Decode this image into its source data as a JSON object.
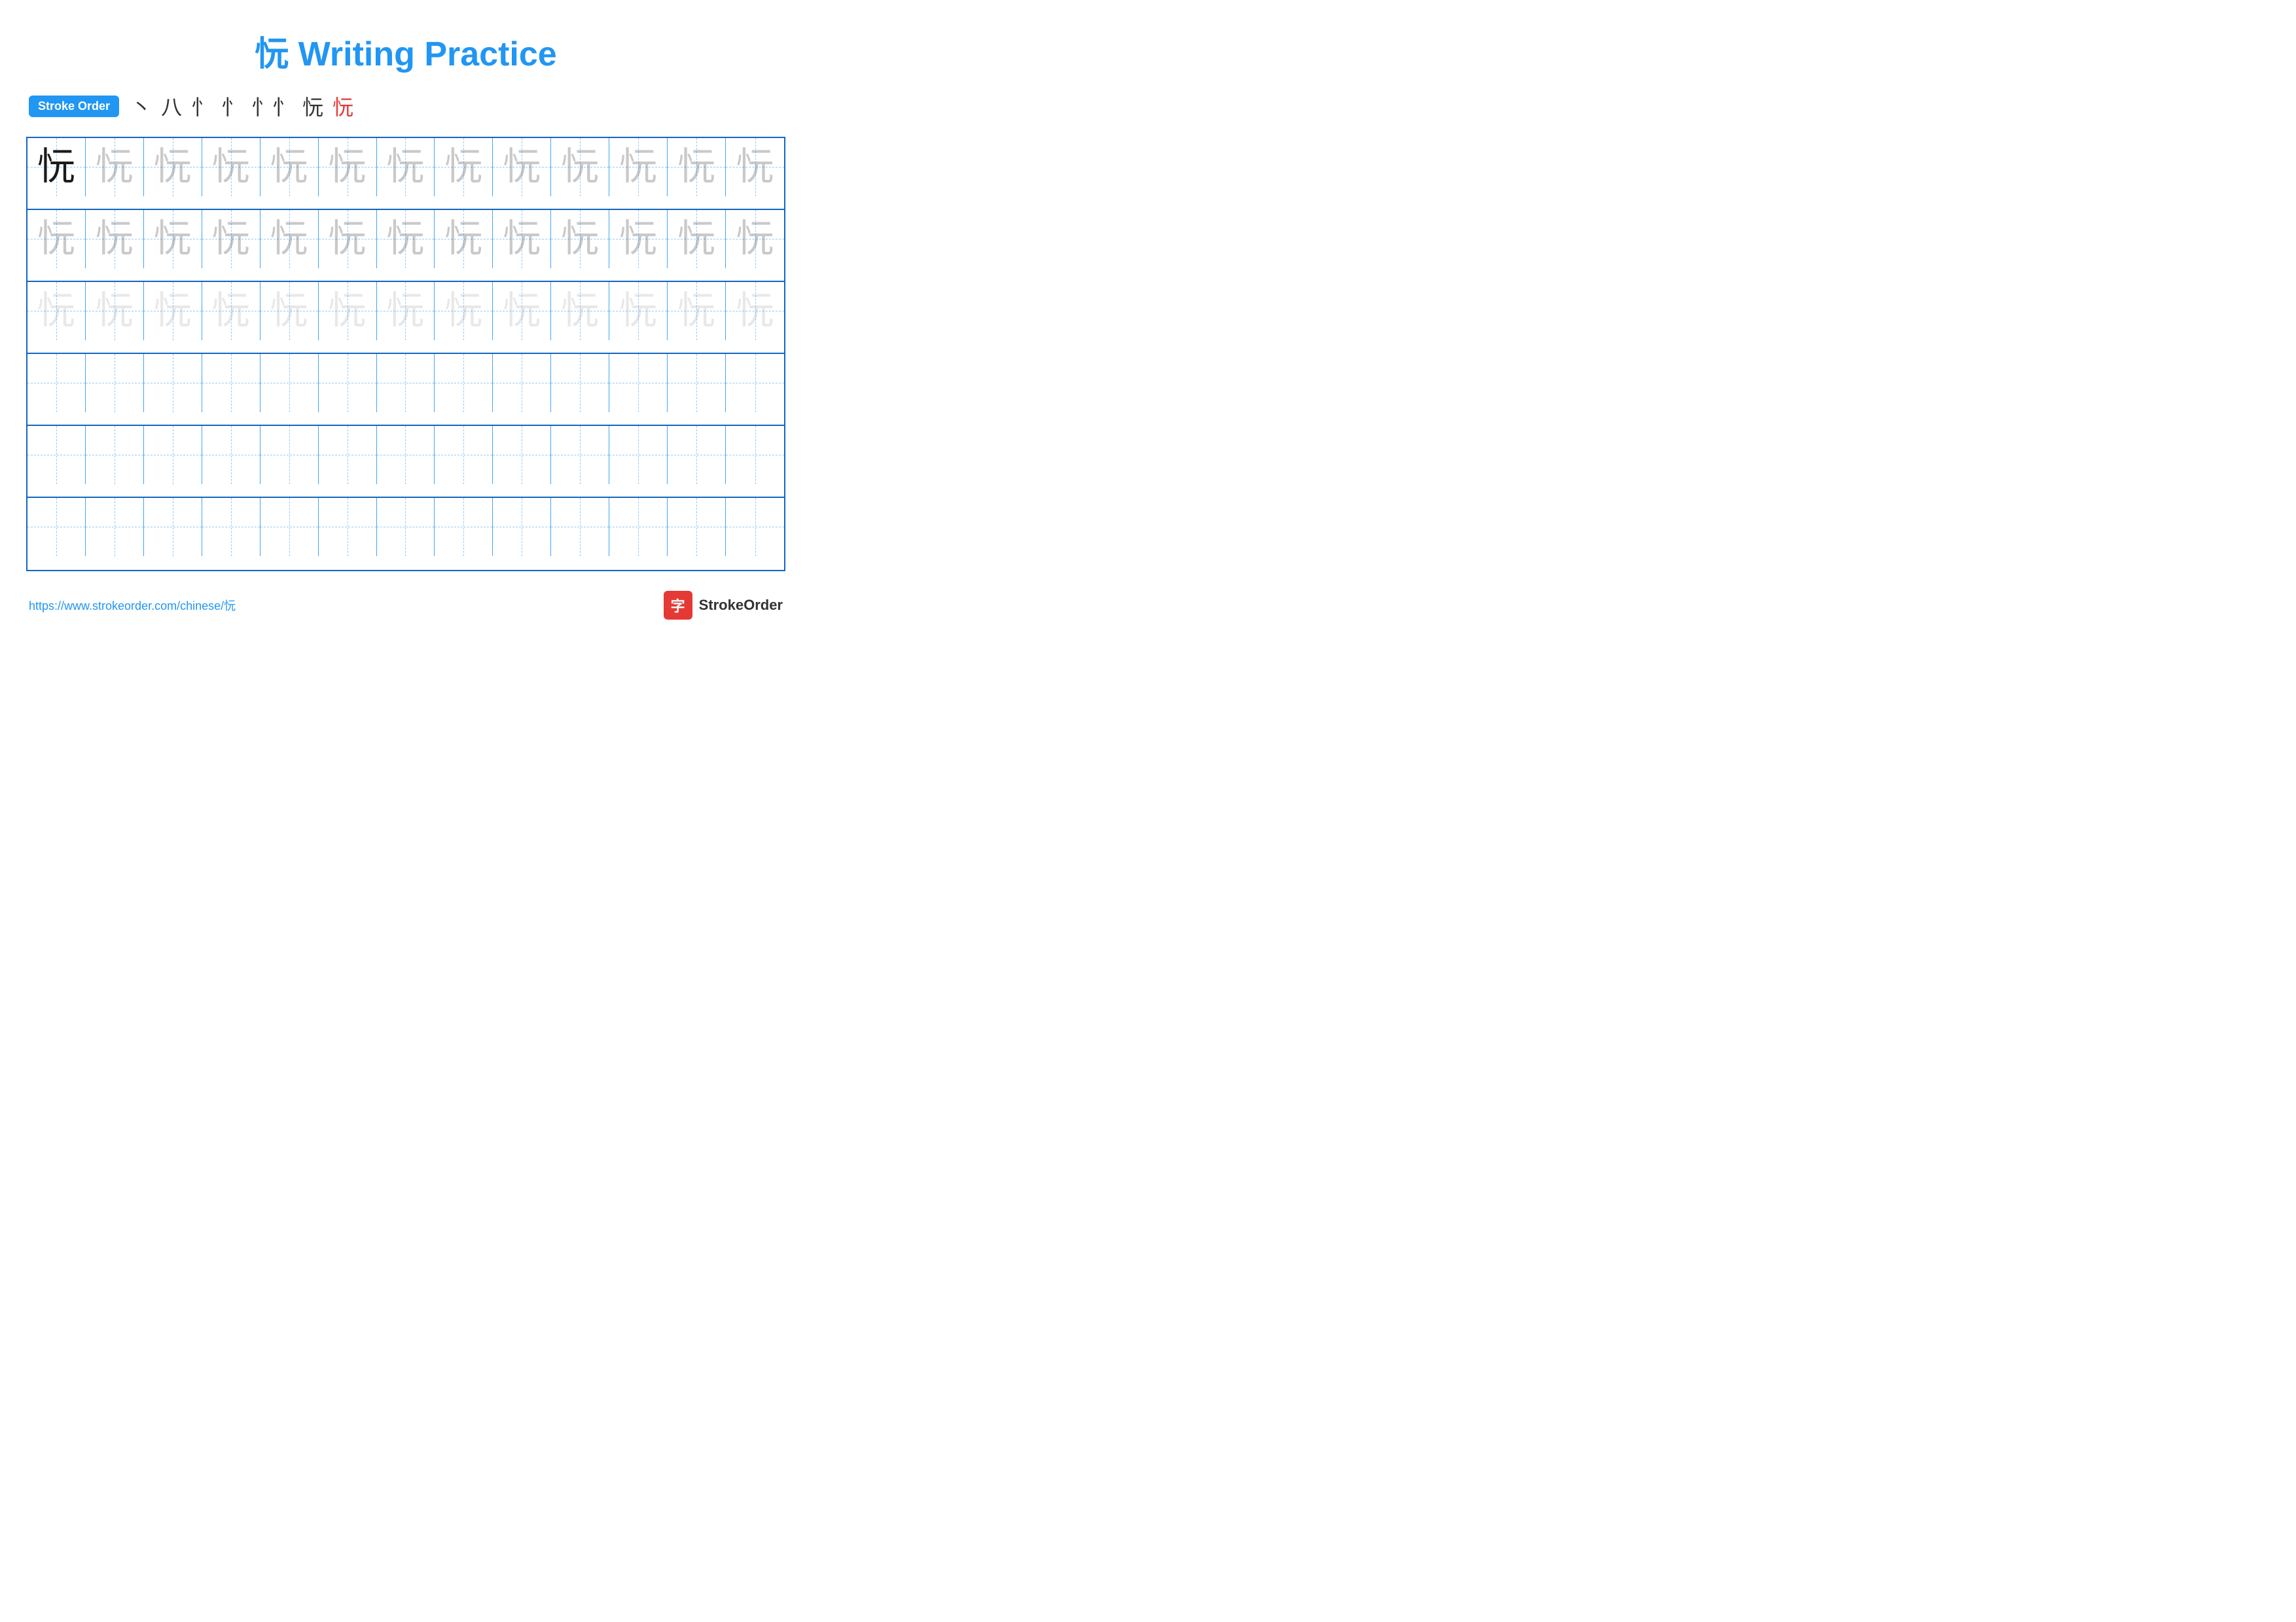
{
  "title": "忨 Writing Practice",
  "stroke_order": {
    "label": "Stroke Order",
    "strokes": [
      "丶",
      "八",
      "忄",
      "忄",
      "忄忄",
      "忨",
      "忨"
    ]
  },
  "character": "忨",
  "grid": {
    "rows": 6,
    "cols": 13
  },
  "footer": {
    "url": "https://www.strokeorder.com/chinese/忨",
    "logo_char": "字",
    "logo_text": "StrokeOrder"
  },
  "row_types": [
    "dark_then_light1",
    "light1",
    "light2",
    "empty",
    "empty",
    "empty"
  ]
}
